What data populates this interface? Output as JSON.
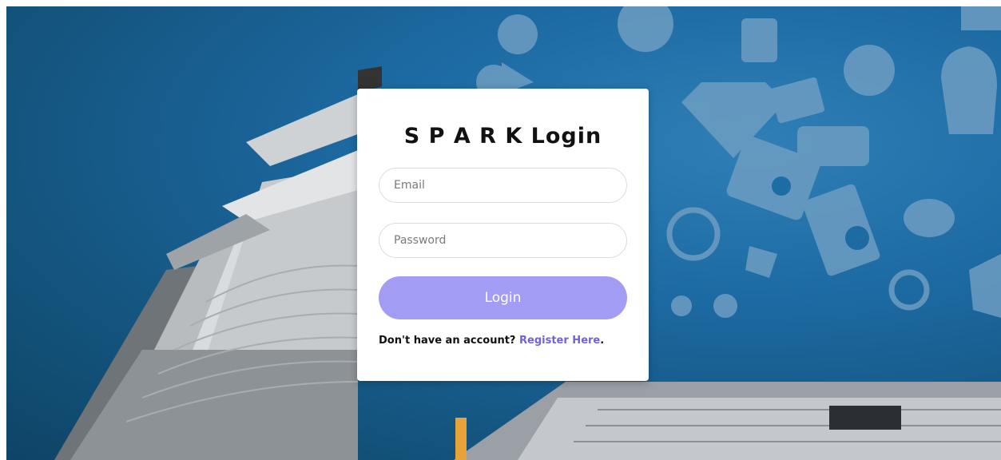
{
  "login": {
    "title": "S P A R K Login",
    "email_placeholder": "Email",
    "password_placeholder": "Password",
    "button_label": "Login",
    "register_prompt": "Don't have an account?",
    "register_link": "Register Here",
    "register_suffix": "."
  },
  "colors": {
    "button": "#a39cf5",
    "link": "#6f63d8",
    "background": "#1d6aa3"
  }
}
